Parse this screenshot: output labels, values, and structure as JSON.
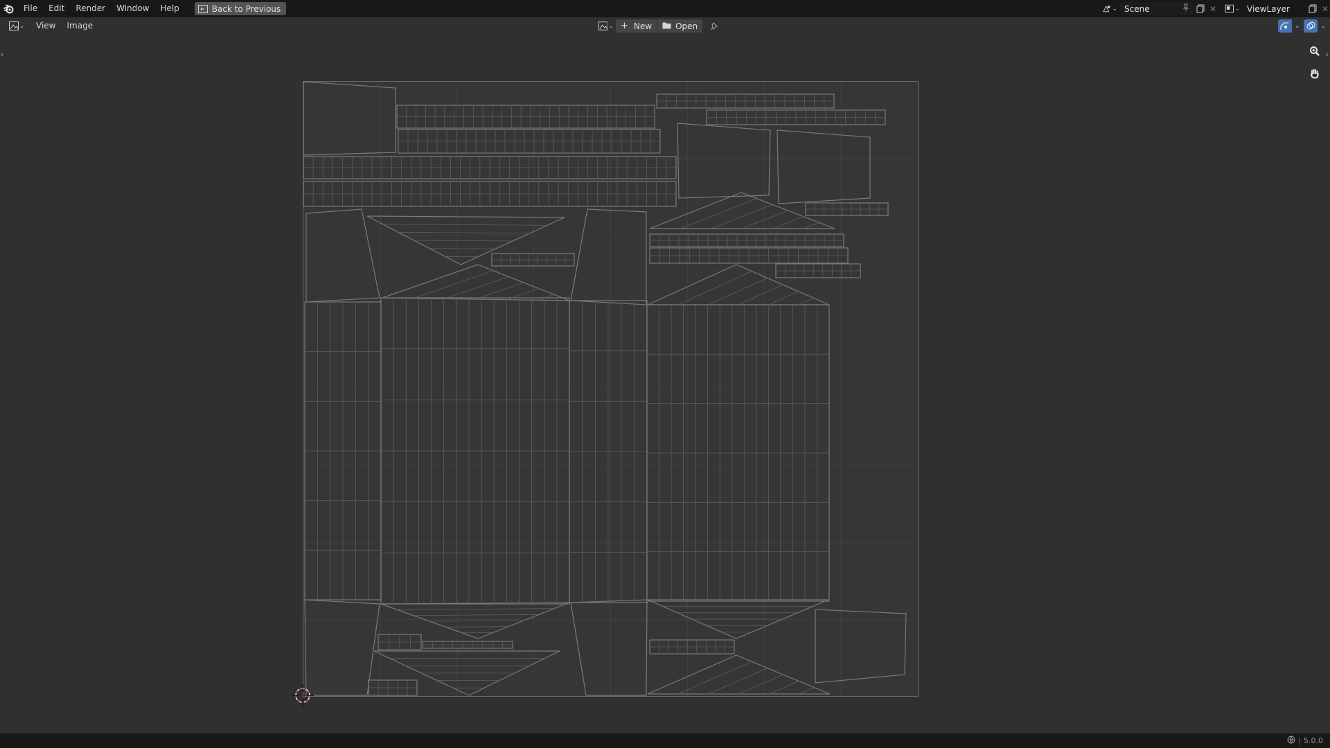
{
  "topbar": {
    "menus": [
      "File",
      "Edit",
      "Render",
      "Window",
      "Help"
    ],
    "back_label": "Back to Previous",
    "scene_name": "Scene",
    "view_layer_name": "ViewLayer"
  },
  "header": {
    "menus": [
      "View",
      "Image"
    ],
    "new_label": "New",
    "open_label": "Open"
  },
  "status": {
    "version": "5.0.0"
  },
  "colors": {
    "topbar_bg": "#181818",
    "editor_bg": "#303030",
    "wire": "#6e6e6e",
    "accent": "#4772b3"
  },
  "icons": {
    "logo": "blender-logo-icon",
    "back": "back-to-previous-icon",
    "editor_type": "image-editor-icon",
    "new": "plus-icon",
    "open": "folder-icon",
    "pin": "pin-icon",
    "zoom": "zoom-icon",
    "pan": "hand-icon",
    "cursor": "2d-cursor-icon"
  }
}
